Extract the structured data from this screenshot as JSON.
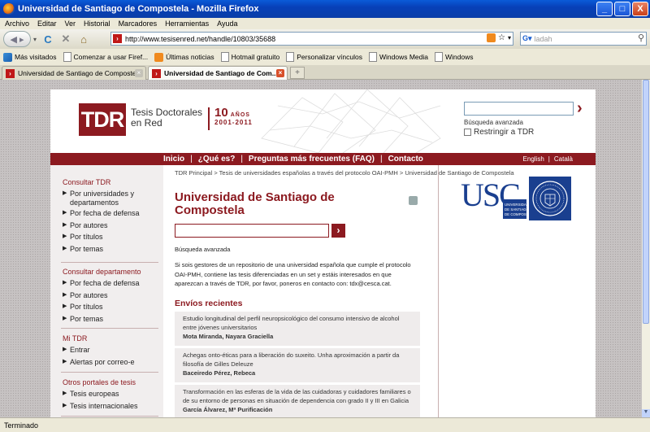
{
  "window": {
    "title": "Universidad de Santiago de Compostela - Mozilla Firefox",
    "buttons": {
      "minimize": "_",
      "maximize": "□",
      "close": "X"
    }
  },
  "menu": [
    "Archivo",
    "Editar",
    "Ver",
    "Historial",
    "Marcadores",
    "Herramientas",
    "Ayuda"
  ],
  "navbar": {
    "url": "http://www.tesisenred.net/handle/10803/35688",
    "search_placeholder": "ladah",
    "icons": [
      "back-icon",
      "forward-icon",
      "reload-icon",
      "stop-icon",
      "home-icon"
    ]
  },
  "bookmarks": [
    {
      "label": "Más visitados",
      "icon": "firefox-icon"
    },
    {
      "label": "Comenzar a usar Firef...",
      "icon": "page-icon"
    },
    {
      "label": "Últimas noticias",
      "icon": "rss-icon"
    },
    {
      "label": "Hotmail gratuito",
      "icon": "page-icon"
    },
    {
      "label": "Personalizar vínculos",
      "icon": "page-icon"
    },
    {
      "label": "Windows Media",
      "icon": "page-icon"
    },
    {
      "label": "Windows",
      "icon": "page-icon"
    }
  ],
  "tabs": [
    {
      "label": "Universidad de Santiago de Compostela",
      "active": false
    },
    {
      "label": "Universidad de Santiago de Com...",
      "active": true
    }
  ],
  "header": {
    "logo_mark": "TDR",
    "logo_line1": "Tesis Doctorales",
    "logo_line2": "en Red",
    "anniversary_number": "10",
    "anniversary_word": "AÑOS",
    "anniversary_years": "2001-2011",
    "search_go": "›",
    "advanced_search": "Búsqueda avanzada",
    "restrict_label": "Restringir a TDR"
  },
  "mainnav": {
    "items": [
      "Inicio",
      "¿Qué es?",
      "Preguntas más frecuentes (FAQ)",
      "Contacto"
    ],
    "separator": "|",
    "languages": [
      "English",
      "Català"
    ]
  },
  "breadcrumb": "TDR Principal > Tesis de universidades españolas a través del protocolo OAI-PMH > Universidad de Santiago de Compostela",
  "sidebar": {
    "groups": [
      {
        "heading": "Consultar TDR",
        "items": [
          "Por universidades y departamentos",
          "Por fecha de defensa",
          "Por autores",
          "Por títulos",
          "Por temas"
        ]
      },
      {
        "heading": "Consultar departamento",
        "items": [
          "Por fecha de defensa",
          "Por autores",
          "Por títulos",
          "Por temas"
        ]
      },
      {
        "heading": "Mi TDR",
        "items": [
          "Entrar",
          "Alertas por correo-e"
        ]
      },
      {
        "heading": "Otros portales de tesis",
        "items": [
          "Tesis europeas",
          "Tesis internacionales"
        ]
      }
    ],
    "bullet": "▶"
  },
  "main": {
    "title": "Universidad de Santiago de Compostela",
    "go": "›",
    "advanced_search": "Búsqueda avanzada",
    "intro": "Si sois gestores de un repositorio de una universidad española que cumple el protocolo OAI-PMH, contiene las tesis diferenciadas en un set y estáis interesados en que aparezcan a través de TDR, por favor, poneros en contacto con: tdx@cesca.cat.",
    "recent_heading": "Envíos recientes",
    "recent": [
      {
        "title": "Estudio longitudinal del perfil neuropsicológico del consumo intensivo de alcohol entre jóvenes universitarios",
        "author": "Mota Miranda, Nayara Graciella"
      },
      {
        "title": "Achegas onto-éticas para a liberación do suxeito. Unha aproximación a partir da filosofía de Gilles Deleuze",
        "author": "Baceiredo Pérez, Rebeca"
      },
      {
        "title": "Transformación en las esferas de la vida de las cuidadoras y cuidadores familiares o de su entorno de personas en situación de dependencia con grado II y III en Galicia",
        "author": "García Álvarez, Mª Purificación"
      }
    ]
  },
  "usc": {
    "letters": "USC",
    "sub": [
      "UNIVERSIDADE",
      "DE SANTIAGO",
      "DE COMPOSTELA"
    ],
    "color": "#1a3f8f"
  },
  "status": "Terminado",
  "colors": {
    "brand": "#8c1a20",
    "usc_blue": "#1a3f8f"
  }
}
